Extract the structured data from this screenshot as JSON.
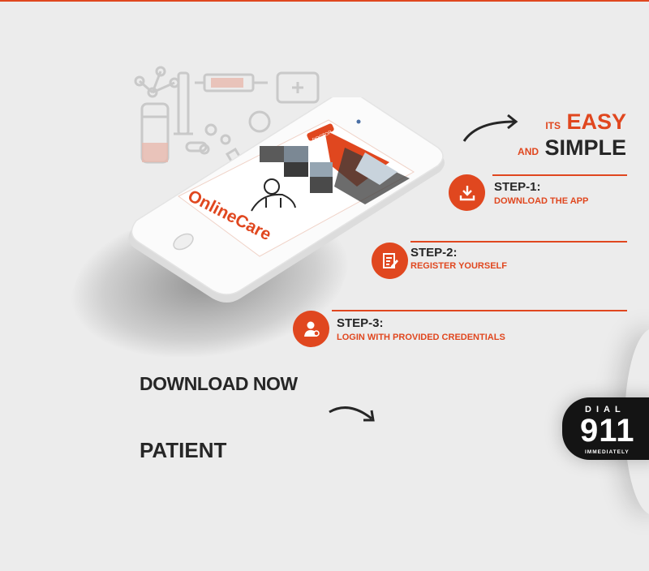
{
  "heading": {
    "its": "ITS",
    "easy": "EASY",
    "and": "AND",
    "simple": "SIMPLE"
  },
  "steps": [
    {
      "title": "STEP-1:",
      "subtitle": "DOWNLOAD THE APP",
      "icon": "download-icon"
    },
    {
      "title": "STEP-2:",
      "subtitle": "REGISTER YOURSELF",
      "icon": "edit-form-icon"
    },
    {
      "title": "STEP-3:",
      "subtitle": "LOGIN WITH PROVIDED CREDENTIALS",
      "icon": "doctor-user-icon"
    }
  ],
  "download_now": "DOWNLOAD NOW",
  "patient": "PATIENT",
  "phone": {
    "tag": "DOCTOR",
    "logo_text": "OnlineCare"
  },
  "dial_badge": {
    "top": "DIAL",
    "number": "911",
    "bottom": "IMMEDIATELY"
  },
  "colors": {
    "accent": "#e0471f",
    "dark": "#262626",
    "background": "#ececec",
    "badge": "#141414"
  }
}
